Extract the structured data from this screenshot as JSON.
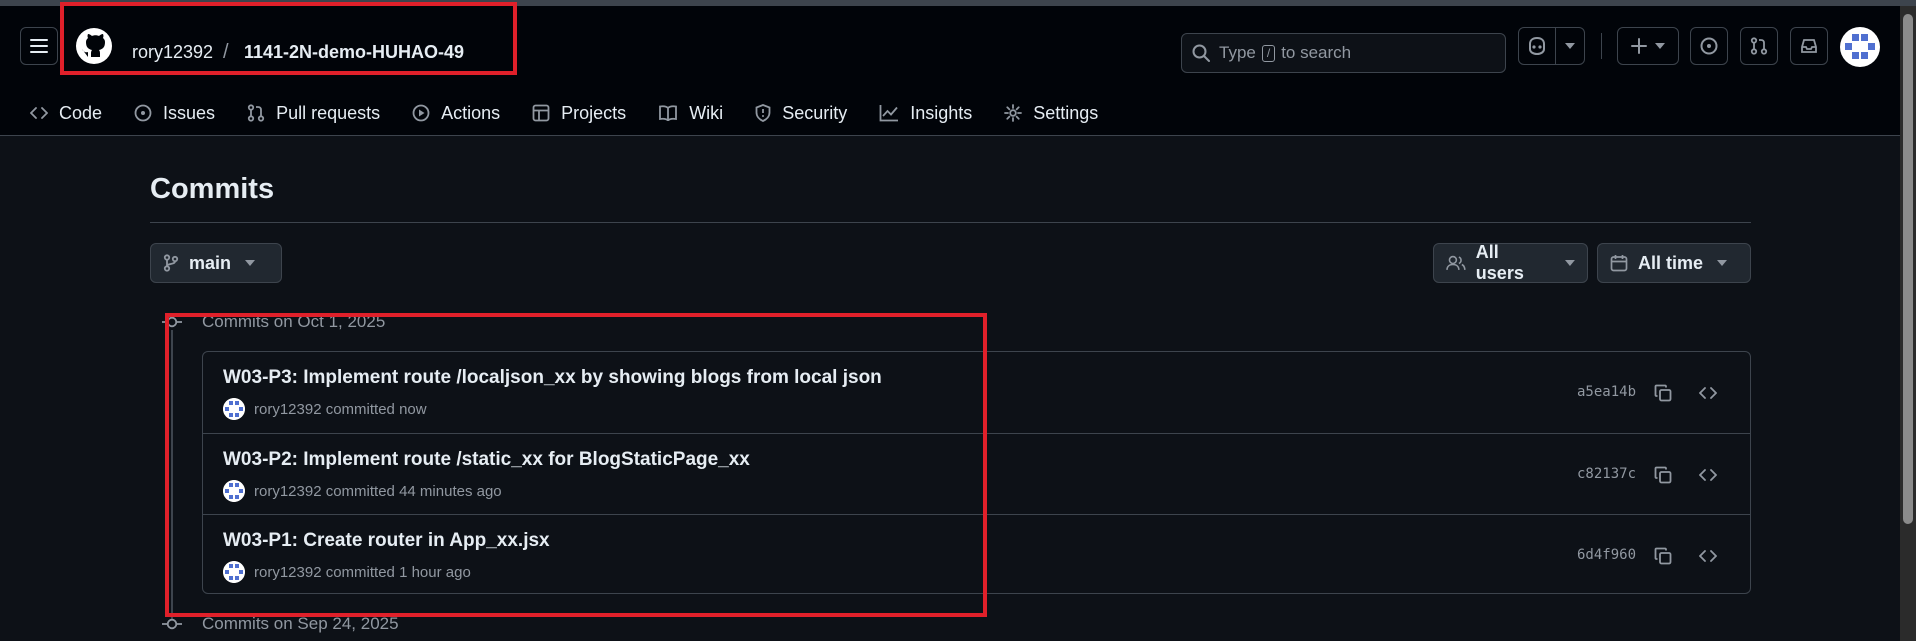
{
  "header": {
    "repo_owner": "rory12392",
    "separator": "/",
    "repo_name": "1141-2N-demo-HUHAO-49",
    "search": {
      "prefix": "Type",
      "key": "/",
      "suffix": "to search"
    }
  },
  "nav": {
    "tabs": [
      {
        "label": "Code",
        "icon": "code-icon"
      },
      {
        "label": "Issues",
        "icon": "issue-icon"
      },
      {
        "label": "Pull requests",
        "icon": "pull-request-icon"
      },
      {
        "label": "Actions",
        "icon": "play-icon"
      },
      {
        "label": "Projects",
        "icon": "table-icon"
      },
      {
        "label": "Wiki",
        "icon": "book-icon"
      },
      {
        "label": "Security",
        "icon": "shield-icon"
      },
      {
        "label": "Insights",
        "icon": "graph-icon"
      },
      {
        "label": "Settings",
        "icon": "gear-icon"
      }
    ]
  },
  "page": {
    "title": "Commits",
    "branch": "main",
    "users_filter": "All users",
    "time_filter": "All time"
  },
  "groups": [
    {
      "label": "Commits on Oct 1, 2025",
      "commits": [
        {
          "message": "W03-P3: Implement route /localjson_xx by showing blogs from local json",
          "author": "rory12392",
          "action": "committed",
          "time": "now",
          "sha": "a5ea14b"
        },
        {
          "message": "W03-P2: Implement route /static_xx for BlogStaticPage_xx",
          "author": "rory12392",
          "action": "committed",
          "time": "44 minutes ago",
          "sha": "c82137c"
        },
        {
          "message": "W03-P1: Create router in App_xx.jsx",
          "author": "rory12392",
          "action": "committed",
          "time": "1 hour ago",
          "sha": "6d4f960"
        }
      ]
    },
    {
      "label": "Commits on Sep 24, 2025"
    }
  ],
  "colors": {
    "background": "#0d1117",
    "header": "#010409",
    "border": "#3d444d",
    "text": "#e6edf3",
    "muted": "#9198a1",
    "annotation": "#e0202a"
  }
}
